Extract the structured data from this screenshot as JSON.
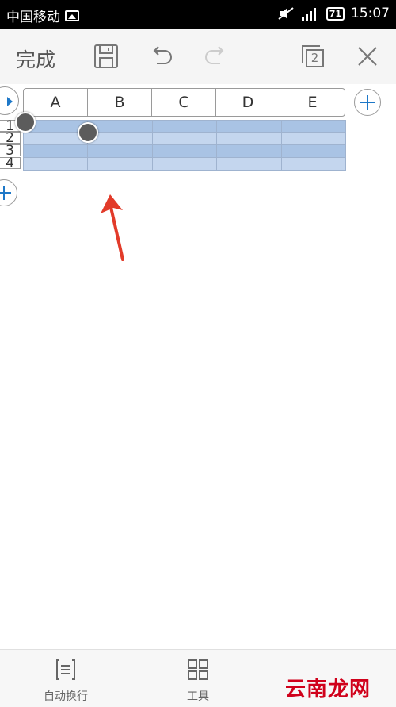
{
  "status_bar": {
    "carrier": "中国移动",
    "battery": "71",
    "time": "15:07"
  },
  "toolbar": {
    "done_label": "完成",
    "tab_count": "2"
  },
  "sheet": {
    "columns": [
      "A",
      "B",
      "C",
      "D",
      "E"
    ],
    "rows": [
      "1",
      "2",
      "3",
      "4"
    ]
  },
  "bottom_bar": {
    "items": [
      {
        "label": "自动换行",
        "icon": "wrap-text-icon"
      },
      {
        "label": "工具",
        "icon": "tools-grid-icon"
      }
    ]
  },
  "watermark": "云南龙网",
  "colors": {
    "selection_fill": "#a9c3e4",
    "selection_fill_light": "#c4d6ee",
    "accent": "#1e78c8",
    "annotation_arrow": "#e23b2a"
  }
}
